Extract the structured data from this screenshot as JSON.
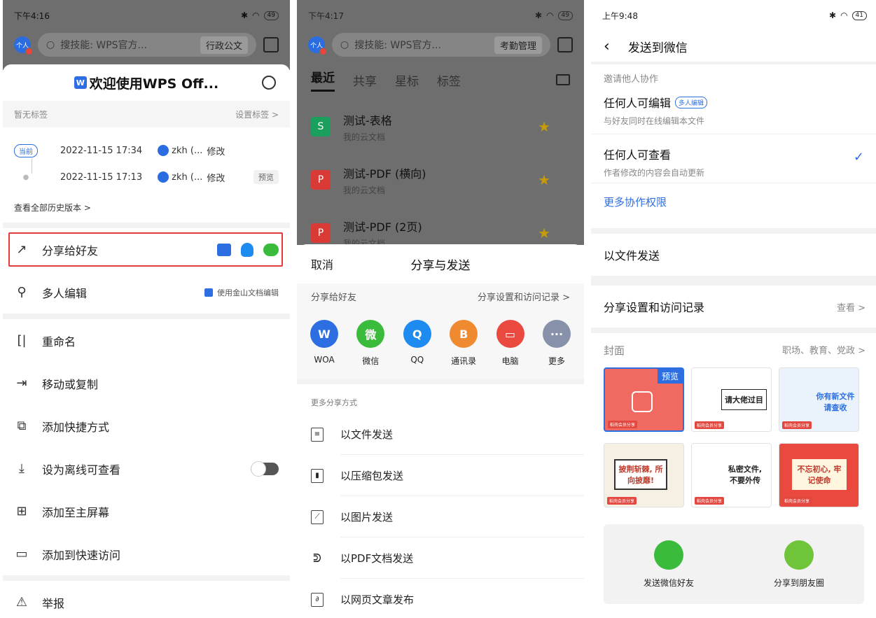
{
  "screen1": {
    "time": "下午4:16",
    "battery": "49",
    "search_placeholder": "搜技能: WPS官方...",
    "search_tag": "行政公文",
    "avatar_text": "个人",
    "title": "欢迎使用WPS Off...",
    "logo_letter": "W",
    "tags_label": "暂无标签",
    "tags_action": "设置标签 >",
    "history": [
      {
        "badge": "当前",
        "time": "2022-11-15 17:34",
        "user": "zkh (...",
        "action": "修改",
        "extra": ""
      },
      {
        "badge": "",
        "time": "2022-11-15 17:13",
        "user": "zkh (...",
        "action": "修改",
        "extra": "预览"
      }
    ],
    "history_all": "查看全部历史版本 >",
    "menu": [
      {
        "label": "分享给好友",
        "icon": "share-icon"
      },
      {
        "label": "多人编辑",
        "icon": "user-add-icon",
        "right": "使用金山文档编辑"
      },
      {
        "label": "重命名",
        "icon": "rename-icon"
      },
      {
        "label": "移动或复制",
        "icon": "move-icon"
      },
      {
        "label": "添加快捷方式",
        "icon": "shortcut-icon"
      },
      {
        "label": "设为离线可查看",
        "icon": "download-icon"
      },
      {
        "label": "添加至主屏幕",
        "icon": "plus-box-icon"
      },
      {
        "label": "添加到快速访问",
        "icon": "quick-access-icon"
      },
      {
        "label": "举报",
        "icon": "warning-icon"
      }
    ]
  },
  "screen2": {
    "time": "下午4:17",
    "battery": "49",
    "search_placeholder": "搜技能: WPS官方...",
    "search_tag": "考勤管理",
    "avatar_text": "个人",
    "tabs": [
      "最近",
      "共享",
      "星标",
      "标签"
    ],
    "files": [
      {
        "name": "测试-表格",
        "sub": "我的云文档",
        "color": "#1aa05c",
        "glyph": "S"
      },
      {
        "name": "测试-PDF (横向)",
        "sub": "我的云文档",
        "color": "#d93a35",
        "glyph": "P"
      },
      {
        "name": "测试-PDF (2页)",
        "sub": "我的云文档",
        "color": "#d93a35",
        "glyph": "P"
      }
    ],
    "cancel": "取消",
    "sheet_title": "分享与发送",
    "share_label": "分享给好友",
    "share_settings": "分享设置和访问记录 >",
    "targets": [
      {
        "label": "WOA",
        "color": "#2d6fe3",
        "glyph": "W"
      },
      {
        "label": "微信",
        "color": "#3bbb3b",
        "glyph": "微"
      },
      {
        "label": "QQ",
        "color": "#1e8bf0",
        "glyph": "Q"
      },
      {
        "label": "通讯录",
        "color": "#f08a30",
        "glyph": "B"
      },
      {
        "label": "电脑",
        "color": "#e9493f",
        "glyph": "▭"
      },
      {
        "label": "更多",
        "color": "#8891aa",
        "glyph": "···"
      }
    ],
    "more_label": "更多分享方式",
    "send_options": [
      {
        "label": "以文件发送",
        "icon": "file-icon"
      },
      {
        "label": "以压缩包发送",
        "icon": "zip-icon"
      },
      {
        "label": "以图片发送",
        "icon": "image-icon"
      },
      {
        "label": "以PDF文档发送",
        "icon": "pdf-icon"
      },
      {
        "label": "以网页文章发布",
        "icon": "webpage-icon"
      }
    ]
  },
  "screen3": {
    "time": "上午9:48",
    "battery": "41",
    "title": "发送到微信",
    "invite_label": "邀请他人协作",
    "perm_edit_title": "任何人可编辑",
    "perm_edit_pill": "多人编辑",
    "perm_edit_sub": "与好友同时在线编辑本文件",
    "perm_view_title": "任何人可查看",
    "perm_view_sub": "作者修改的内容会自动更新",
    "more_perm": "更多协作权限",
    "send_as_file": "以文件发送",
    "share_settings": "分享设置和访问记录",
    "view": "查看 >",
    "cover_label": "封面",
    "cover_tags": "职场、教育、党政 >",
    "covers": [
      {
        "text": "预览",
        "bg": "#f06a62",
        "fg": "#ffffff"
      },
      {
        "text": "请大佬过目",
        "bg": "#ffffff",
        "fg": "#222222"
      },
      {
        "text": "你有新文件 请查收",
        "bg": "#eaf3fb",
        "fg": "#2d6fe3"
      },
      {
        "text": "披荆斩棘, 所向披靡!",
        "bg": "#f6efe3",
        "fg": "#c0392b"
      },
      {
        "text": "私密文件, 不要外传",
        "bg": "#ffffff",
        "fg": "#222222"
      },
      {
        "text": "不忘初心, 牢记使命",
        "bg": "#e9493f",
        "fg": "#fff2c0"
      }
    ],
    "cover_caption": "稻壳会员分享",
    "send_friend": "发送微信好友",
    "share_moments": "分享到朋友圈"
  }
}
